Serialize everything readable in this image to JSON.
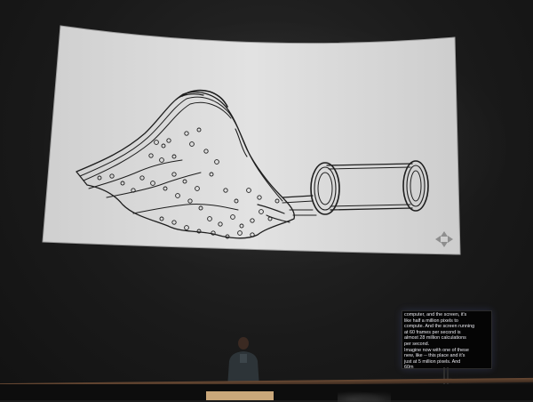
{
  "slide": {
    "colors": {
      "screen": "#d9d9d9",
      "line": "#1b1b1b",
      "background": "#1b1b1b"
    },
    "icons": [
      "move-arrows-icon"
    ]
  },
  "captions": {
    "text": "computer, and the screen, it's\nlike half a million pixels to\ncompute.  And the screen running\nat 60 frames per second is\nalmost 28 million calculations\nper second.\nImagine now with one of these\nnew, like -- this place and it's\njust at 5 million pixels.  And\n60m"
  }
}
